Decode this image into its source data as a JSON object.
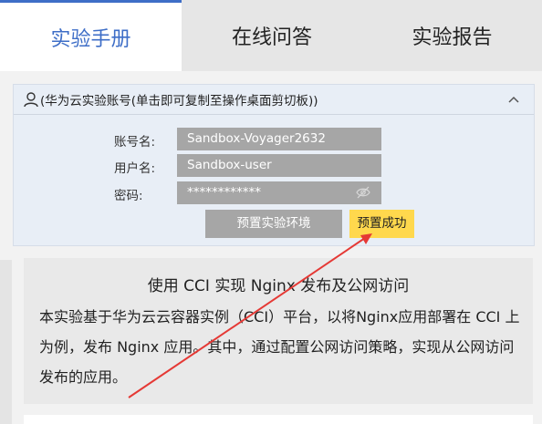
{
  "tabs": [
    {
      "label": "实验手册",
      "active": true
    },
    {
      "label": "在线问答",
      "active": false
    },
    {
      "label": "实验报告",
      "active": false
    }
  ],
  "account": {
    "header": "(华为云实验账号(单击即可复制至操作桌面剪切板))",
    "rows": [
      {
        "label": "账号名:",
        "value": "Sandbox-Voyager2632"
      },
      {
        "label": "用户名:",
        "value": "Sandbox-user"
      },
      {
        "label": "密码:",
        "value": "************"
      }
    ],
    "buttons": {
      "env": "预置实验环境",
      "success": "预置成功"
    }
  },
  "content": {
    "title": "使用 CCI 实现 Nginx 发布及公网访问",
    "body": "本实验基于华为云云容器实例（CCI）平台，以将Nginx应用部署在 CCI 上为例，发布 Nginx 应用。其中，通过配置公网访问策略，实现从公网访问发布的应用。"
  },
  "colors": {
    "accent": "#3e6ec7",
    "success_button": "#ffd84d",
    "arrow": "#e53935"
  },
  "icons": [
    "user-icon",
    "chevron-up-icon",
    "eye-off-icon"
  ]
}
